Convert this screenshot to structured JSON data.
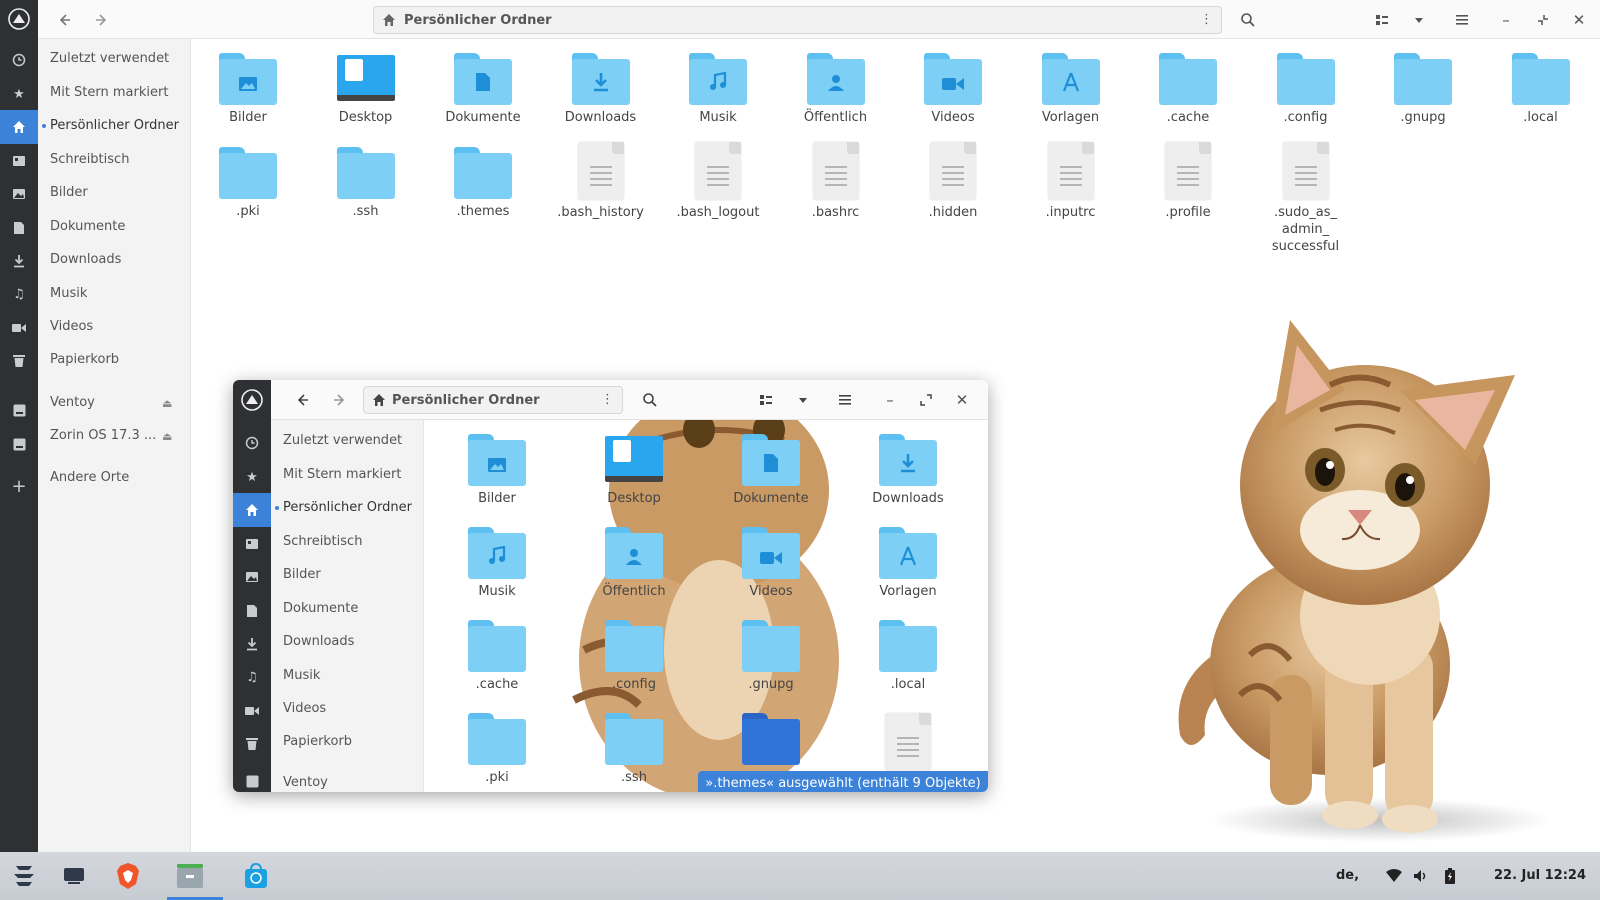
{
  "main_window": {
    "path_label": "Persönlicher Ordner",
    "sidebar": [
      {
        "label": "Zuletzt verwendet",
        "icon": "clock-icon"
      },
      {
        "label": "Mit Stern markiert",
        "icon": "star-icon"
      },
      {
        "label": "Persönlicher Ordner",
        "icon": "home-icon",
        "active": true
      },
      {
        "label": "Schreibtisch",
        "icon": "desktop-icon"
      },
      {
        "label": "Bilder",
        "icon": "image-icon"
      },
      {
        "label": "Dokumente",
        "icon": "document-icon"
      },
      {
        "label": "Downloads",
        "icon": "download-icon"
      },
      {
        "label": "Musik",
        "icon": "music-icon"
      },
      {
        "label": "Videos",
        "icon": "video-icon"
      },
      {
        "label": "Papierkorb",
        "icon": "trash-icon"
      },
      {
        "label": "Ventoy",
        "icon": "drive-icon",
        "eject": true
      },
      {
        "label": "Zorin OS 17.3 ...",
        "icon": "drive-icon",
        "eject": true
      },
      {
        "label": "Andere Orte",
        "icon": "plus-icon"
      }
    ],
    "items_row1": [
      "Bilder",
      "Desktop",
      "Dokumente",
      "Downloads",
      "Musik",
      "Öffentlich",
      "Videos",
      "Vorlagen",
      ".cache",
      ".config",
      ".gnupg",
      ".local"
    ],
    "items_row2": [
      ".pki",
      ".ssh",
      ".themes",
      ".bash_history",
      ".bash_logout",
      ".bashrc",
      ".hidden",
      ".inputrc",
      ".profile",
      ".sudo_as_\nadmin_\nsuccessful"
    ]
  },
  "small_window": {
    "path_label": "Persönlicher Ordner",
    "sidebar": [
      "Zuletzt verwendet",
      "Mit Stern markiert",
      "Persönlicher Ordner",
      "Schreibtisch",
      "Bilder",
      "Dokumente",
      "Downloads",
      "Musik",
      "Videos",
      "Papierkorb",
      "Ventoy"
    ],
    "items": [
      "Bilder",
      "Desktop",
      "Dokumente",
      "Downloads",
      "Musik",
      "Öffentlich",
      "Videos",
      "Vorlagen",
      ".cache",
      ".config",
      ".gnupg",
      ".local",
      ".pki",
      ".ssh",
      "",
      ""
    ],
    "status": "».themes« ausgewählt  (enthält 9 Objekte)"
  },
  "taskbar": {
    "keyboard_layout": "de,",
    "datetime": "22. Jul  12:24"
  },
  "colors": {
    "accent": "#3c82d8",
    "folder": "#7dcff6",
    "rail": "#2e3033"
  }
}
